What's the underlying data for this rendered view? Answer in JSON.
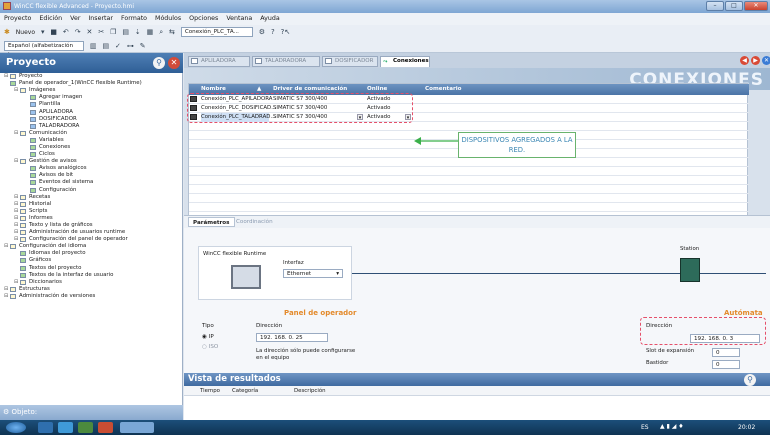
{
  "window": {
    "title": "WinCC flexible Advanced - Proyecto.hmi",
    "min": "–",
    "max": "□",
    "close": "✕"
  },
  "menu": [
    "Proyecto",
    "Edición",
    "Ver",
    "Insertar",
    "Formato",
    "Módulos",
    "Opciones",
    "Ventana",
    "Ayuda"
  ],
  "toolbar": {
    "new_label": "Nuevo",
    "connection_combo": "Conexión_PLC_TA...",
    "language_combo": "Español (alfabetización in..."
  },
  "project_panel": {
    "title": "Proyecto",
    "tree": [
      {
        "label": "Proyecto",
        "level": 0,
        "icon": "folder"
      },
      {
        "label": "Panel de operador_1(WinCC flexible Runtime)",
        "level": 0,
        "icon": "device"
      },
      {
        "label": "Imágenes",
        "level": 1,
        "icon": "folder"
      },
      {
        "label": "Agregar imagen",
        "level": 2,
        "icon": "add"
      },
      {
        "label": "Plantilla",
        "level": 2,
        "icon": "screen"
      },
      {
        "label": "APLILADORA",
        "level": 2,
        "icon": "screen"
      },
      {
        "label": "DOSIFICADOR",
        "level": 2,
        "icon": "screen"
      },
      {
        "label": "TALADRADORA",
        "level": 2,
        "icon": "screen"
      },
      {
        "label": "Comunicación",
        "level": 1,
        "icon": "folder"
      },
      {
        "label": "Variables",
        "level": 2,
        "icon": "tag"
      },
      {
        "label": "Conexiones",
        "level": 2,
        "icon": "connection"
      },
      {
        "label": "Ciclos",
        "level": 2,
        "icon": "cycle"
      },
      {
        "label": "Gestión de avisos",
        "level": 1,
        "icon": "folder"
      },
      {
        "label": "Avisos analógicos",
        "level": 2,
        "icon": "alarm"
      },
      {
        "label": "Avisos de bit",
        "level": 2,
        "icon": "alarm"
      },
      {
        "label": "Eventos del sistema",
        "level": 2,
        "icon": "alarm"
      },
      {
        "label": "Configuración",
        "level": 2,
        "icon": "settings"
      },
      {
        "label": "Recetas",
        "level": 1,
        "icon": "folder"
      },
      {
        "label": "Historial",
        "level": 1,
        "icon": "folder"
      },
      {
        "label": "Scripts",
        "level": 1,
        "icon": "folder"
      },
      {
        "label": "Informes",
        "level": 1,
        "icon": "folder"
      },
      {
        "label": "Texto y lista de gráficos",
        "level": 1,
        "icon": "folder"
      },
      {
        "label": "Administración de usuarios runtime",
        "level": 1,
        "icon": "folder"
      },
      {
        "label": "Configuración del panel de operador",
        "level": 1,
        "icon": "folder"
      },
      {
        "label": "Configuración del idioma",
        "level": 0,
        "icon": "folder"
      },
      {
        "label": "Idiomas del proyecto",
        "level": 1,
        "icon": "globe"
      },
      {
        "label": "Gráficos",
        "level": 1,
        "icon": "graphics"
      },
      {
        "label": "Textos del proyecto",
        "level": 1,
        "icon": "text"
      },
      {
        "label": "Textos de la interfaz de usuario",
        "level": 1,
        "icon": "text"
      },
      {
        "label": "Diccionarios",
        "level": 1,
        "icon": "folder"
      },
      {
        "label": "Estructuras",
        "level": 0,
        "icon": "folder"
      },
      {
        "label": "Administración de versiones",
        "level": 0,
        "icon": "folder"
      }
    ]
  },
  "editor_tabs": [
    "APLILADORA",
    "TALADRADORA",
    "DOSIFICADOR",
    "Conexiones"
  ],
  "banner": "CONEXIONES",
  "connections_table": {
    "headers": [
      "Nombre",
      "Driver de comunicación",
      "Online",
      "Comentario"
    ],
    "rows": [
      {
        "name": "Conexión_PLC_APILADORA",
        "driver": "SIMATIC S7 300/400",
        "online": "Activado",
        "comment": ""
      },
      {
        "name": "Conexión_PLC_DOSIFICAD...",
        "driver": "SIMATIC S7 300/400",
        "online": "Activado",
        "comment": ""
      },
      {
        "name": "Conexión_PLC_TALADRAD...",
        "driver": "SIMATIC S7 300/400",
        "online": "Activado",
        "comment": ""
      }
    ]
  },
  "annotation": "DISPOSITIVOS AGREGADOS A LA RED.",
  "params": {
    "tab_params": "Parámetros",
    "tab_coord": "Coordinación",
    "runtime_label": "WinCC flexible Runtime",
    "interface_label": "Interfaz",
    "interface_value": "Ethernet",
    "station_label": "Station",
    "panel_header": "Panel de operador",
    "type_label": "Tipo",
    "ip_label": "IP",
    "iso_label": "ISO",
    "address_label": "Dirección",
    "panel_ip": "192. 168. 0. 25",
    "panel_note": "La dirección sólo puede configurarse en el equipo",
    "plc_header": "Autómata",
    "plc_address_label": "Dirección",
    "plc_ip": "192. 168. 0. 3",
    "slot_label": "Slot de expansión",
    "slot_value": "0",
    "rack_label": "Bastidor",
    "rack_value": "0"
  },
  "results": {
    "title": "Vista de resultados",
    "cols": [
      "Tiempo",
      "Categoría",
      "Descripción"
    ]
  },
  "objeto_label": "Objeto:",
  "taskbar": {
    "lang": "ES",
    "time": "20:02"
  }
}
